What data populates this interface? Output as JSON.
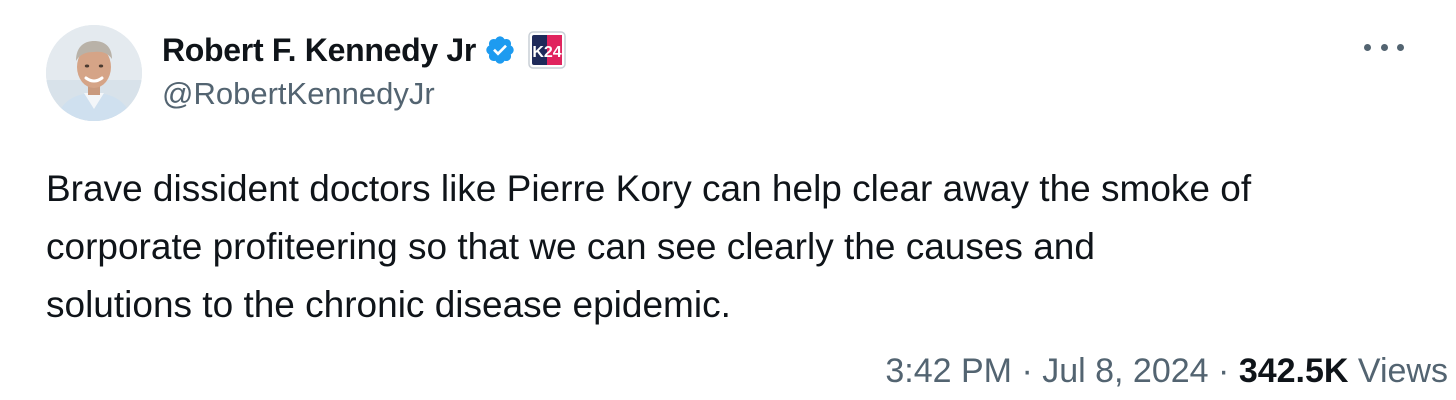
{
  "author": {
    "display_name": "Robert F. Kennedy Jr",
    "handle": "@RobertKennedyJr",
    "verified_icon": "verified-check-icon",
    "badge_text": "K24",
    "avatar_icon": "profile-photo"
  },
  "more_icon": "more-horizontal-icon",
  "tweet": {
    "lines": [
      "Brave dissident doctors like Pierre Kory can help clear away the smoke of",
      "corporate profiteering so that we can see clearly the causes and",
      "solutions to the chronic disease epidemic."
    ]
  },
  "meta": {
    "time": "3:42 PM",
    "separator": "·",
    "date": "Jul 8, 2024",
    "views_count": "342.5K",
    "views_label": "Views"
  },
  "colors": {
    "text_primary": "#0f1419",
    "text_secondary": "#536471",
    "verified_blue": "#1d9bf0",
    "badge_navy": "#1f2a5a",
    "badge_red": "#e0245e"
  }
}
